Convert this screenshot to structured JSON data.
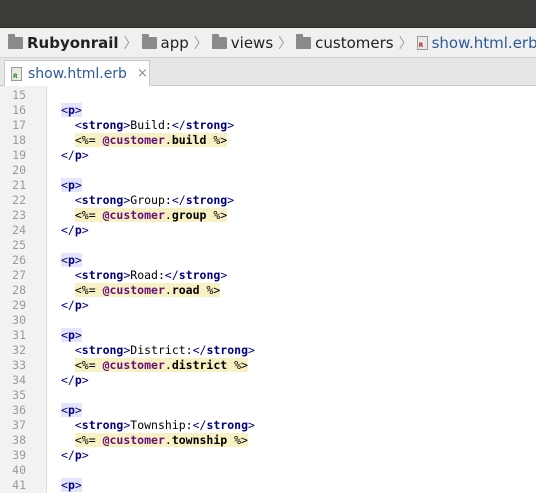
{
  "breadcrumb": {
    "project": "Rubyonrail",
    "folders": [
      "app",
      "views",
      "customers"
    ],
    "file": "show.html.erb"
  },
  "tabs": [
    {
      "label": "show.html.erb",
      "close": "×"
    }
  ],
  "editor": {
    "lines": [
      {
        "n": "15",
        "type": "blank"
      },
      {
        "n": "16",
        "type": "open_p"
      },
      {
        "n": "17",
        "type": "strong",
        "label": "Build:"
      },
      {
        "n": "18",
        "type": "erb",
        "ivar": "@customer",
        "method": "build"
      },
      {
        "n": "19",
        "type": "close_p"
      },
      {
        "n": "20",
        "type": "blank"
      },
      {
        "n": "21",
        "type": "open_p"
      },
      {
        "n": "22",
        "type": "strong",
        "label": "Group:"
      },
      {
        "n": "23",
        "type": "erb",
        "ivar": "@customer",
        "method": "group"
      },
      {
        "n": "24",
        "type": "close_p"
      },
      {
        "n": "25",
        "type": "blank"
      },
      {
        "n": "26",
        "type": "open_p"
      },
      {
        "n": "27",
        "type": "strong",
        "label": "Road:"
      },
      {
        "n": "28",
        "type": "erb",
        "ivar": "@customer",
        "method": "road"
      },
      {
        "n": "29",
        "type": "close_p"
      },
      {
        "n": "30",
        "type": "blank"
      },
      {
        "n": "31",
        "type": "open_p"
      },
      {
        "n": "32",
        "type": "strong",
        "label": "District:"
      },
      {
        "n": "33",
        "type": "erb",
        "ivar": "@customer",
        "method": "district"
      },
      {
        "n": "34",
        "type": "close_p"
      },
      {
        "n": "35",
        "type": "blank"
      },
      {
        "n": "36",
        "type": "open_p"
      },
      {
        "n": "37",
        "type": "strong",
        "label": "Township:"
      },
      {
        "n": "38",
        "type": "erb",
        "ivar": "@customer",
        "method": "township"
      },
      {
        "n": "39",
        "type": "close_p"
      },
      {
        "n": "40",
        "type": "blank"
      },
      {
        "n": "41",
        "type": "open_p"
      }
    ]
  }
}
